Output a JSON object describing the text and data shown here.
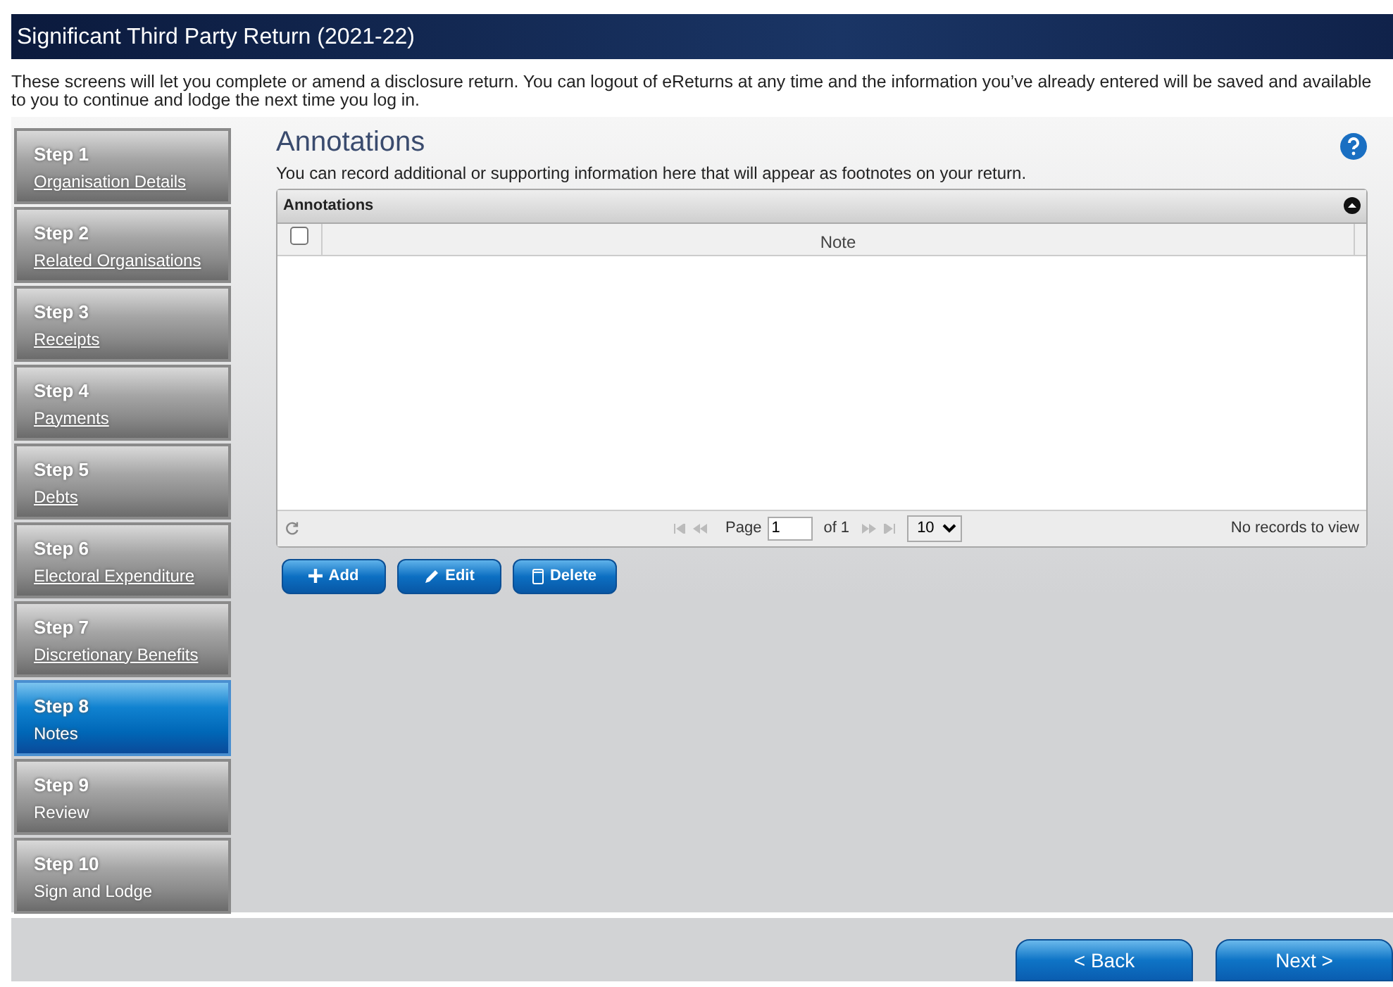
{
  "window": {
    "title": "Significant Third Party Return (2021-22)"
  },
  "intro": "These screens will let you complete or amend a disclosure return. You can logout of eReturns at any time and the information you’ve already entered will be saved and available to you to continue and lodge the next time you log in.",
  "steps": [
    {
      "step": "Step 1",
      "label": "Organisation Details",
      "linked": true,
      "selected": false
    },
    {
      "step": "Step 2",
      "label": "Related Organisations",
      "linked": true,
      "selected": false
    },
    {
      "step": "Step 3",
      "label": "Receipts",
      "linked": true,
      "selected": false
    },
    {
      "step": "Step 4",
      "label": "Payments",
      "linked": true,
      "selected": false
    },
    {
      "step": "Step 5",
      "label": "Debts",
      "linked": true,
      "selected": false
    },
    {
      "step": "Step 6",
      "label": "Electoral Expenditure",
      "linked": true,
      "selected": false
    },
    {
      "step": "Step 7",
      "label": "Discretionary Benefits",
      "linked": true,
      "selected": false
    },
    {
      "step": "Step 8",
      "label": "Notes",
      "linked": false,
      "selected": true
    },
    {
      "step": "Step 9",
      "label": "Review",
      "linked": false,
      "selected": false
    },
    {
      "step": "Step 10",
      "label": "Sign and Lodge",
      "linked": false,
      "selected": false
    }
  ],
  "content": {
    "heading": "Annotations",
    "description": "You can record additional or supporting information here that will appear as footnotes on your return.",
    "grid": {
      "caption": "Annotations",
      "select_all_checked": false,
      "columns": [
        "Note"
      ],
      "pager": {
        "page_label": "Page",
        "page": "1",
        "of": "of 1",
        "page_size": "10",
        "records": "No records to view"
      }
    },
    "actions": [
      {
        "kind": "add",
        "label": "Add"
      },
      {
        "kind": "edit",
        "label": "Edit"
      },
      {
        "kind": "delete",
        "label": "Delete"
      }
    ]
  },
  "footer": {
    "buttons": [
      "< Back",
      "Next >"
    ]
  }
}
